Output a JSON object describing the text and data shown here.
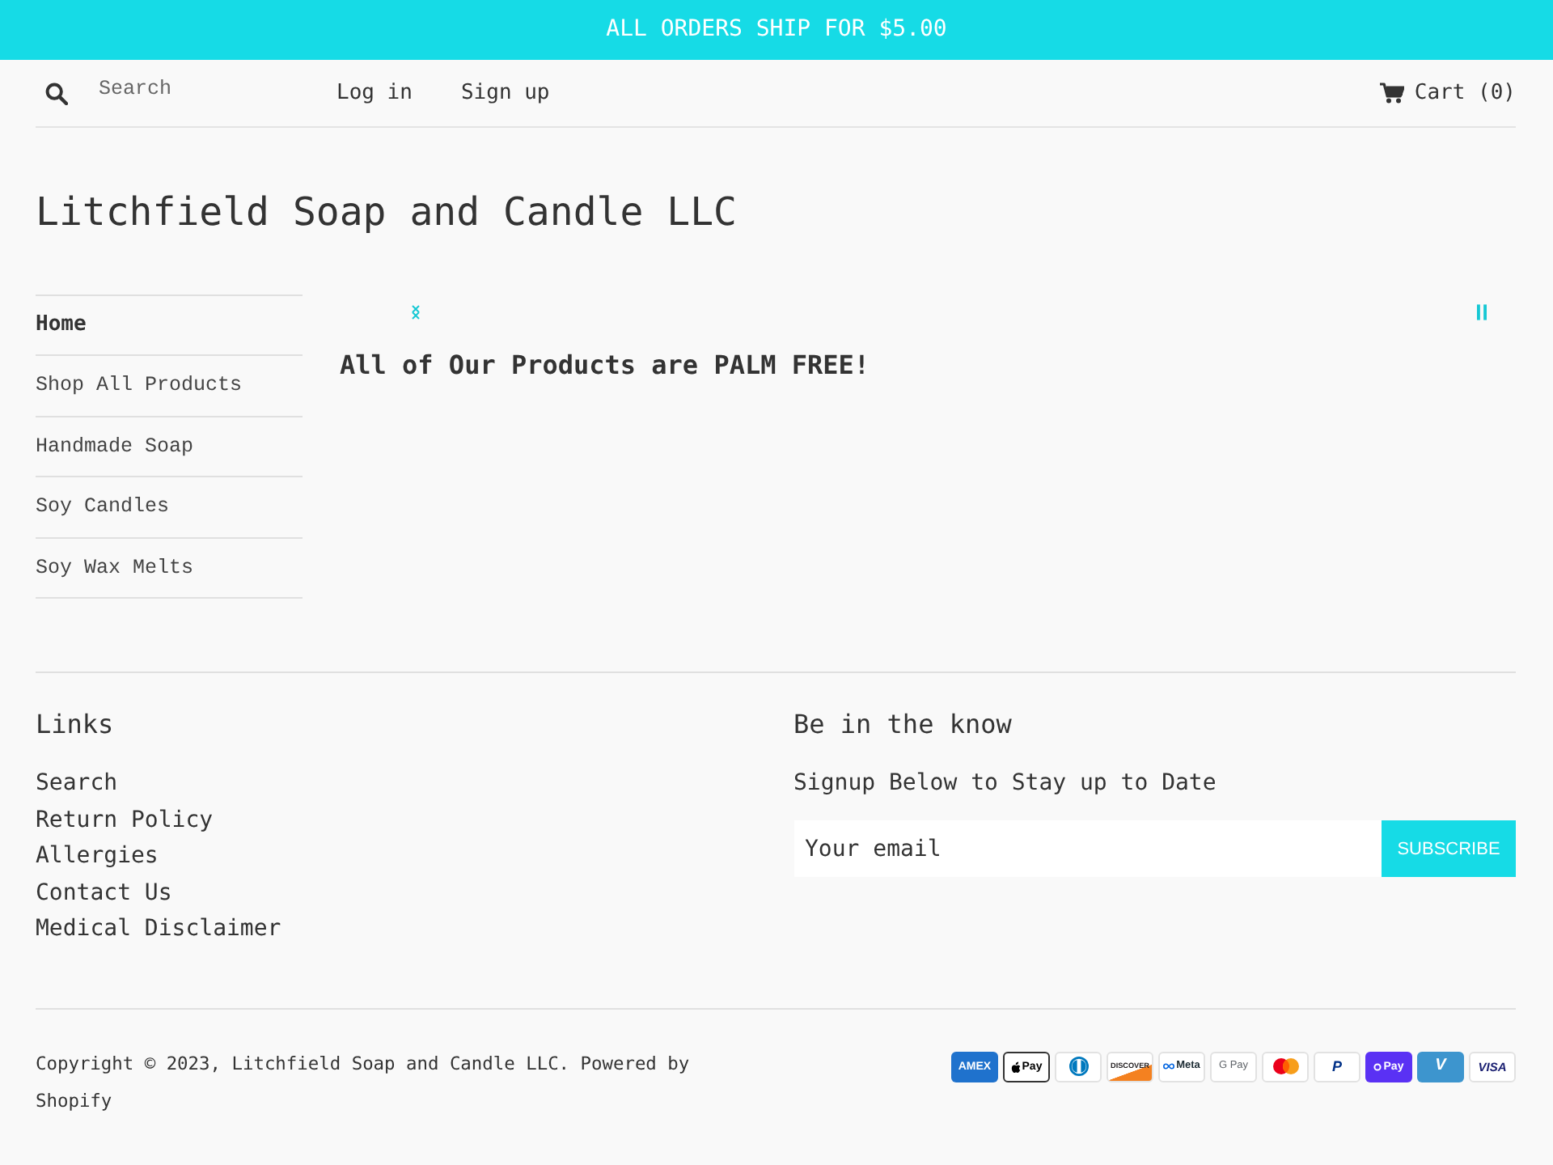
{
  "announcement": {
    "text": "ALL ORDERS SHIP FOR $5.00"
  },
  "header": {
    "search": {
      "placeholder": "Search"
    },
    "links": [
      "Log in",
      "Sign up"
    ],
    "cart": "Cart (0)"
  },
  "site_title": "Litchfield Soap and Candle LLC",
  "sidebar": {
    "items": [
      {
        "label": "Home",
        "selected": true
      },
      {
        "label": "Shop All Products",
        "selected": false
      },
      {
        "label": "Handmade Soap",
        "selected": false
      },
      {
        "label": "Soy Candles",
        "selected": false
      },
      {
        "label": "Soy Wax Melts",
        "selected": false
      }
    ]
  },
  "main": {
    "heading": "All of Our Products are PALM FREE!"
  },
  "footer": {
    "links": {
      "title": "Links",
      "items": [
        "Search",
        "Return Policy",
        "Allergies",
        "Contact Us",
        "Medical Disclaimer"
      ]
    },
    "newsletter": {
      "title": "Be in the know",
      "subtitle": "Signup Below to Stay up to Date",
      "email": {
        "placeholder": "Your email"
      },
      "button": "SUBSCRIBE"
    },
    "copyright": "Copyright © 2023, Litchfield Soap and Candle LLC. Powered by Shopify",
    "payment_icons": [
      {
        "kind": "amex",
        "label": "AMEX",
        "color": "#1f72cd"
      },
      {
        "kind": "apple",
        "label": "Pay",
        "color": "#ffffff"
      },
      {
        "kind": "diners",
        "color": "#ffffff"
      },
      {
        "kind": "discover",
        "label": "DISCOVER",
        "color": "#ffffff"
      },
      {
        "kind": "meta",
        "label": "Meta",
        "color": "#ffffff"
      },
      {
        "kind": "gpay",
        "label": "G Pay",
        "color": "#ffffff"
      },
      {
        "kind": "mastercard",
        "color": "#ffffff"
      },
      {
        "kind": "paypal",
        "label": "P",
        "color": "#ffffff"
      },
      {
        "kind": "shop",
        "label": "Pay",
        "color": "#5a31f4"
      },
      {
        "kind": "venmo",
        "label": "V",
        "color": "#3d95ce"
      },
      {
        "kind": "visa",
        "label": "VISA",
        "color": "#ffffff"
      }
    ]
  }
}
